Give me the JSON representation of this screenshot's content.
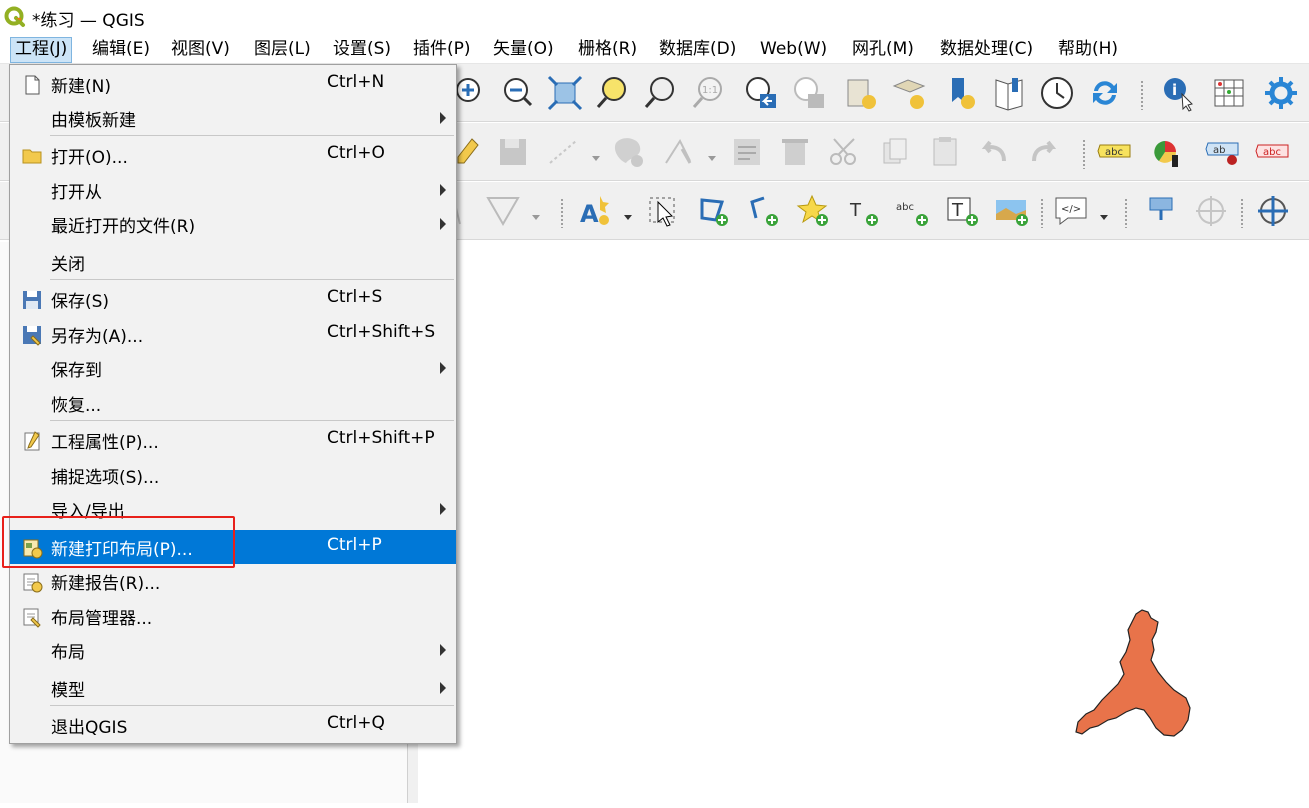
{
  "window": {
    "title": "*练习 — QGIS"
  },
  "menubar": {
    "items": [
      {
        "label": "工程(J)"
      },
      {
        "label": "编辑(E)"
      },
      {
        "label": "视图(V)"
      },
      {
        "label": "图层(L)"
      },
      {
        "label": "设置(S)"
      },
      {
        "label": "插件(P)"
      },
      {
        "label": "矢量(O)"
      },
      {
        "label": "栅格(R)"
      },
      {
        "label": "数据库(D)"
      },
      {
        "label": "Web(W)"
      },
      {
        "label": "网孔(M)"
      },
      {
        "label": "数据处理(C)"
      },
      {
        "label": "帮助(H)"
      }
    ]
  },
  "project_menu": {
    "items": [
      {
        "label": "新建(N)",
        "shortcut": "Ctrl+N",
        "icon": "new-file-icon"
      },
      {
        "label": "由模板新建",
        "shortcut": ""
      },
      {
        "label": "打开(O)...",
        "shortcut": "Ctrl+O",
        "icon": "folder-icon"
      },
      {
        "label": "打开从",
        "shortcut": ""
      },
      {
        "label": "最近打开的文件(R)",
        "shortcut": ""
      },
      {
        "label": "关闭",
        "shortcut": ""
      },
      {
        "label": "保存(S)",
        "shortcut": "Ctrl+S",
        "icon": "save-icon"
      },
      {
        "label": "另存为(A)...",
        "shortcut": "Ctrl+Shift+S",
        "icon": "save-as-icon"
      },
      {
        "label": "保存到",
        "shortcut": ""
      },
      {
        "label": "恢复...",
        "shortcut": ""
      },
      {
        "label": "工程属性(P)...",
        "shortcut": "Ctrl+Shift+P",
        "icon": "project-properties-icon"
      },
      {
        "label": "捕捉选项(S)...",
        "shortcut": ""
      },
      {
        "label": "导入/导出",
        "shortcut": ""
      },
      {
        "label": "新建打印布局(P)...",
        "shortcut": "Ctrl+P",
        "icon": "new-print-layout-icon"
      },
      {
        "label": "新建报告(R)...",
        "shortcut": "",
        "icon": "new-report-icon"
      },
      {
        "label": "布局管理器...",
        "shortcut": "",
        "icon": "layout-manager-icon"
      },
      {
        "label": "布局",
        "shortcut": ""
      },
      {
        "label": "模型",
        "shortcut": ""
      },
      {
        "label": "退出QGIS",
        "shortcut": "Ctrl+Q"
      }
    ]
  },
  "toolbar_labels": {
    "label_abc": "abc",
    "label_ab": "ab",
    "label_abc2": "abc",
    "tool_11": "1:1"
  },
  "colors": {
    "accent": "#0078d7",
    "polygon_fill": "#e8734a",
    "highlight_box": "#e8201a"
  }
}
